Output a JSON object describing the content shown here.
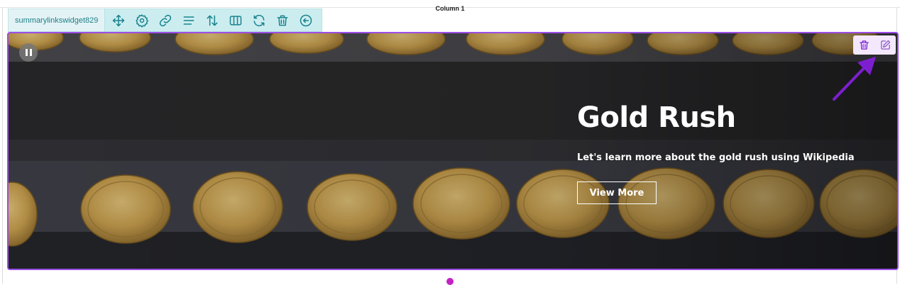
{
  "column": {
    "title": "Column 1"
  },
  "toolbar": {
    "widget_name": "summarylinkswidget829",
    "icons": [
      "move-icon",
      "settings-icon",
      "link-icon",
      "align-icon",
      "sort-icon",
      "columns-icon",
      "refresh-icon",
      "delete-icon",
      "back-icon"
    ]
  },
  "hero": {
    "title": "Gold Rush",
    "subtitle": "Let's learn more about the gold rush using Wikipedia",
    "button_label": "View More",
    "image_subject": "gold coins on dark fabric"
  },
  "colors": {
    "accent": "#9b4ee8",
    "toolbar_bg": "#ccedef",
    "toolbar_icon": "#18838f",
    "handle": "#c420c4",
    "arrow": "#7d1fd1"
  }
}
